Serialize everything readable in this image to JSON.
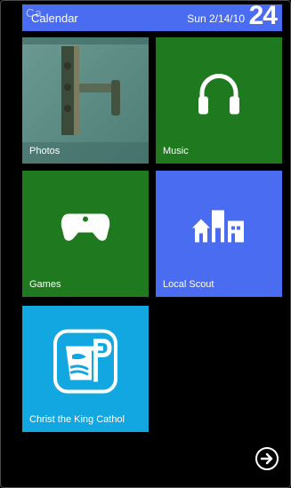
{
  "status": {
    "faint_text": "Ca",
    "title": "Calendar",
    "date": "Sun 2/14/10",
    "day_number": "24"
  },
  "tiles": [
    {
      "label": "Photos",
      "color": "#5b8d86"
    },
    {
      "label": "Music",
      "color": "#1f7a1f"
    },
    {
      "label": "Games",
      "color": "#1f7a1f"
    },
    {
      "label": "Local Scout",
      "color": "#4a6cf0"
    },
    {
      "label": "Christ the King Cathol",
      "color": "#12a7e0"
    }
  ],
  "icons": {
    "music": "headphones-icon",
    "games": "gamepad-icon",
    "scout": "buildings-icon",
    "christ": "church-logo-icon",
    "next": "arrow-right-circle-icon"
  }
}
